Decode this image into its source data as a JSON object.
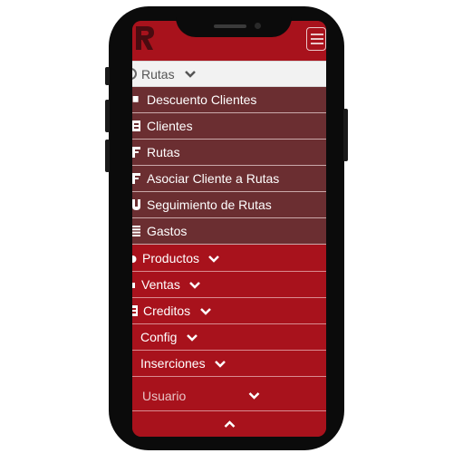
{
  "menu": {
    "rutas": {
      "label": "Rutas"
    },
    "rutas_items": [
      {
        "label": "Descuento Clientes",
        "icon": "square-icon"
      },
      {
        "label": "Clientes",
        "icon": "id-card-icon"
      },
      {
        "label": "Rutas",
        "icon": "flag-icon"
      },
      {
        "label": "Asociar Cliente a Rutas",
        "icon": "flag-icon"
      },
      {
        "label": "Seguimiento de Rutas",
        "icon": "shield-icon"
      },
      {
        "label": "Gastos",
        "icon": "list-icon"
      }
    ],
    "main_items": [
      {
        "label": "Productos"
      },
      {
        "label": "Ventas"
      },
      {
        "label": "Creditos"
      },
      {
        "label": "Config"
      },
      {
        "label": "Inserciones"
      }
    ],
    "usuario": {
      "label": "Usuario"
    }
  },
  "colors": {
    "brand_red": "#a8121c",
    "submenu_bg": "#6b2e31",
    "active_row_bg": "#f2f2f2"
  }
}
